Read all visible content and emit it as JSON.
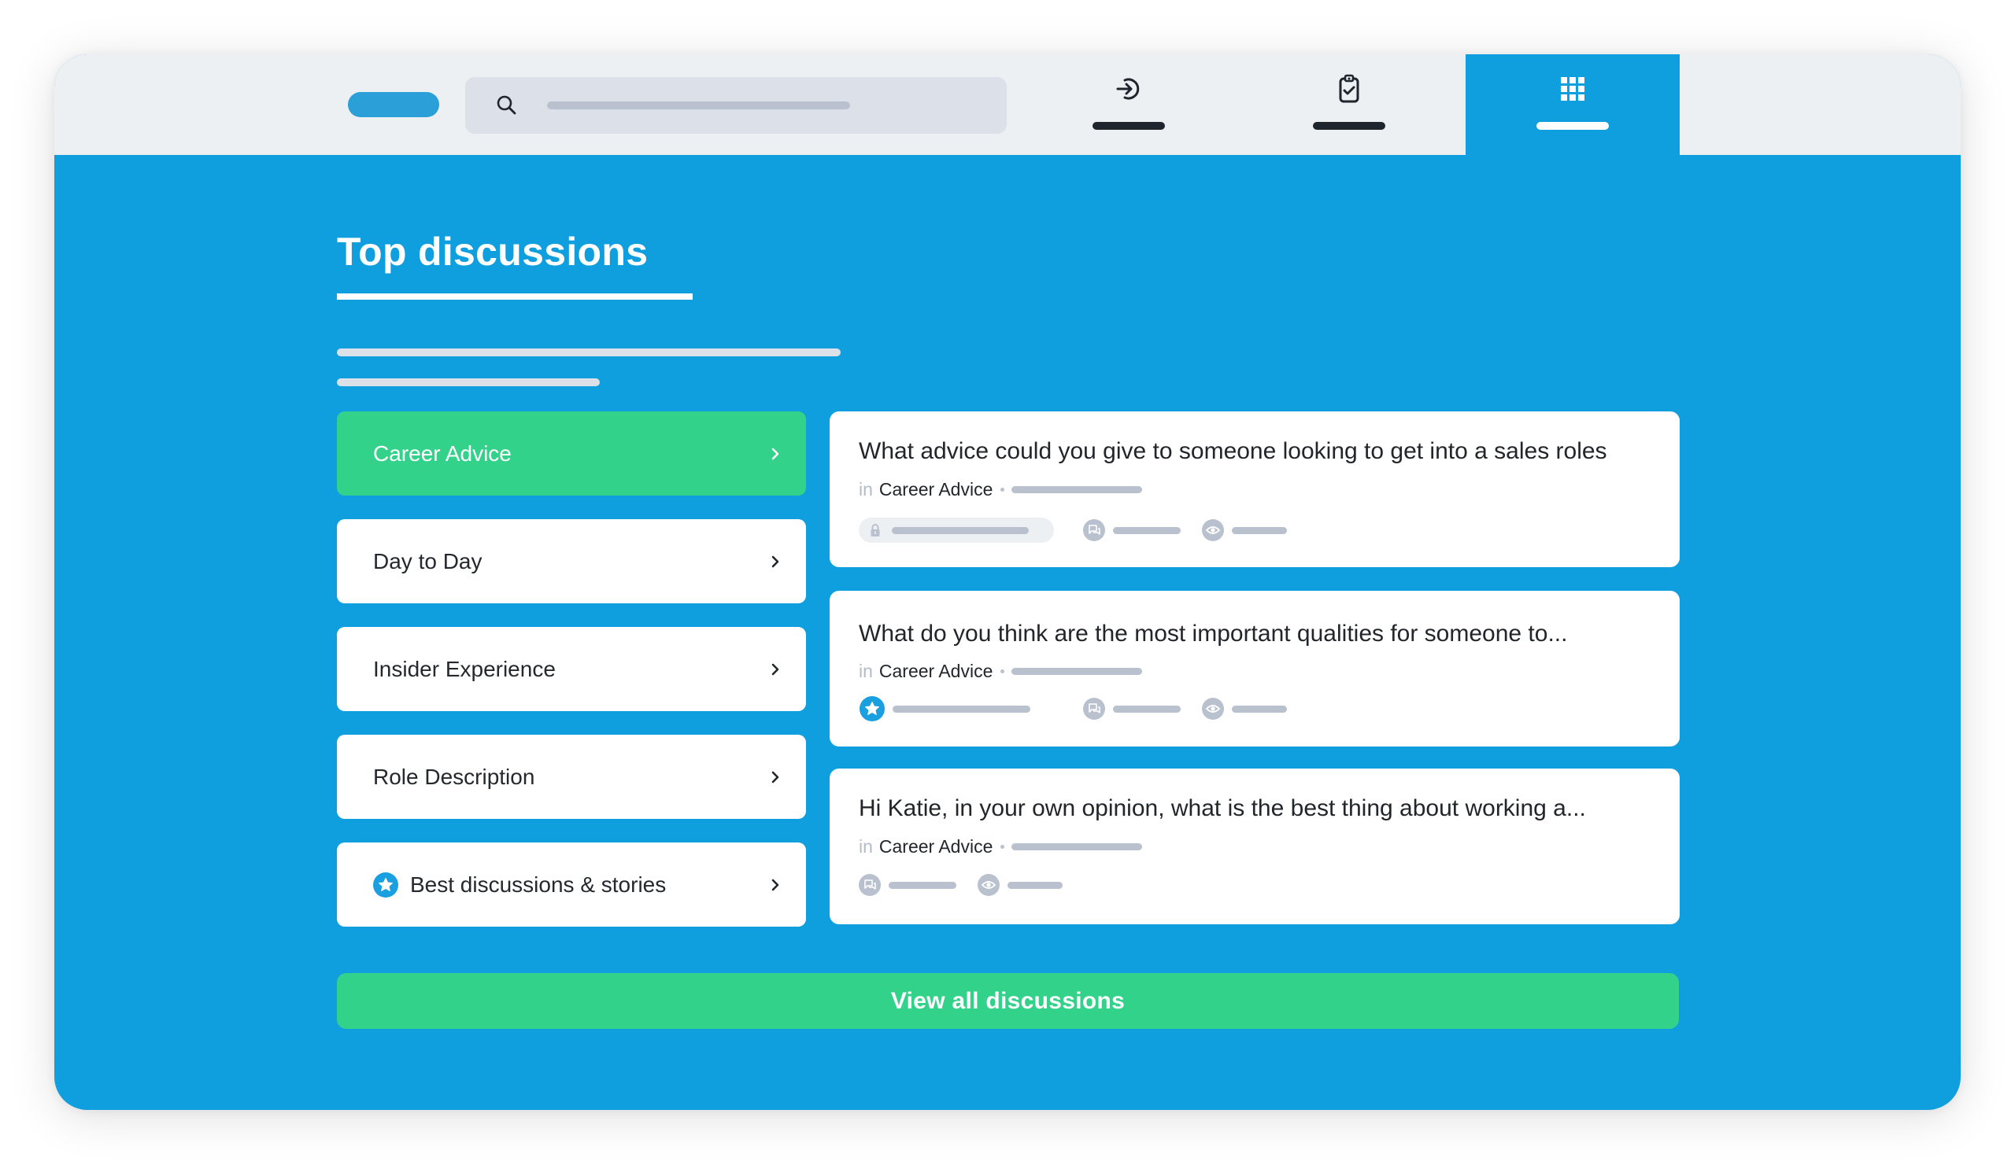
{
  "header": {
    "search": {
      "placeholder": ""
    },
    "tabs": [
      {
        "id": "login",
        "icon": "login-icon",
        "active": false
      },
      {
        "id": "tasks",
        "icon": "clipboard-check-icon",
        "active": false
      },
      {
        "id": "apps",
        "icon": "grid-icon",
        "active": true
      }
    ]
  },
  "main": {
    "title": "Top discussions",
    "categories": [
      {
        "label": "Career Advice",
        "active": true,
        "icon": null
      },
      {
        "label": "Day to Day",
        "active": false,
        "icon": null
      },
      {
        "label": "Insider Experience",
        "active": false,
        "icon": null
      },
      {
        "label": "Role Description",
        "active": false,
        "icon": null
      },
      {
        "label": "Best discussions & stories",
        "active": false,
        "icon": "star-badge-icon"
      }
    ],
    "discussions": [
      {
        "title": "What advice could you give to someone looking to get into a sales roles",
        "in_label": "in",
        "category": "Career Advice",
        "badge": "lock-icon"
      },
      {
        "title": "What do you think are the most important qualities for someone to...",
        "in_label": "in",
        "category": "Career Advice",
        "badge": "star-badge-icon"
      },
      {
        "title": "Hi Katie, in your own opinion, what is the best thing about working a...",
        "in_label": "in",
        "category": "Career Advice",
        "badge": null
      }
    ],
    "view_all_label": "View all discussions"
  },
  "colors": {
    "primary_blue": "#0f9fdf",
    "accent_green": "#33d28a",
    "header_bg": "#edf0f3",
    "placeholder_gray": "#b8c1cd"
  }
}
